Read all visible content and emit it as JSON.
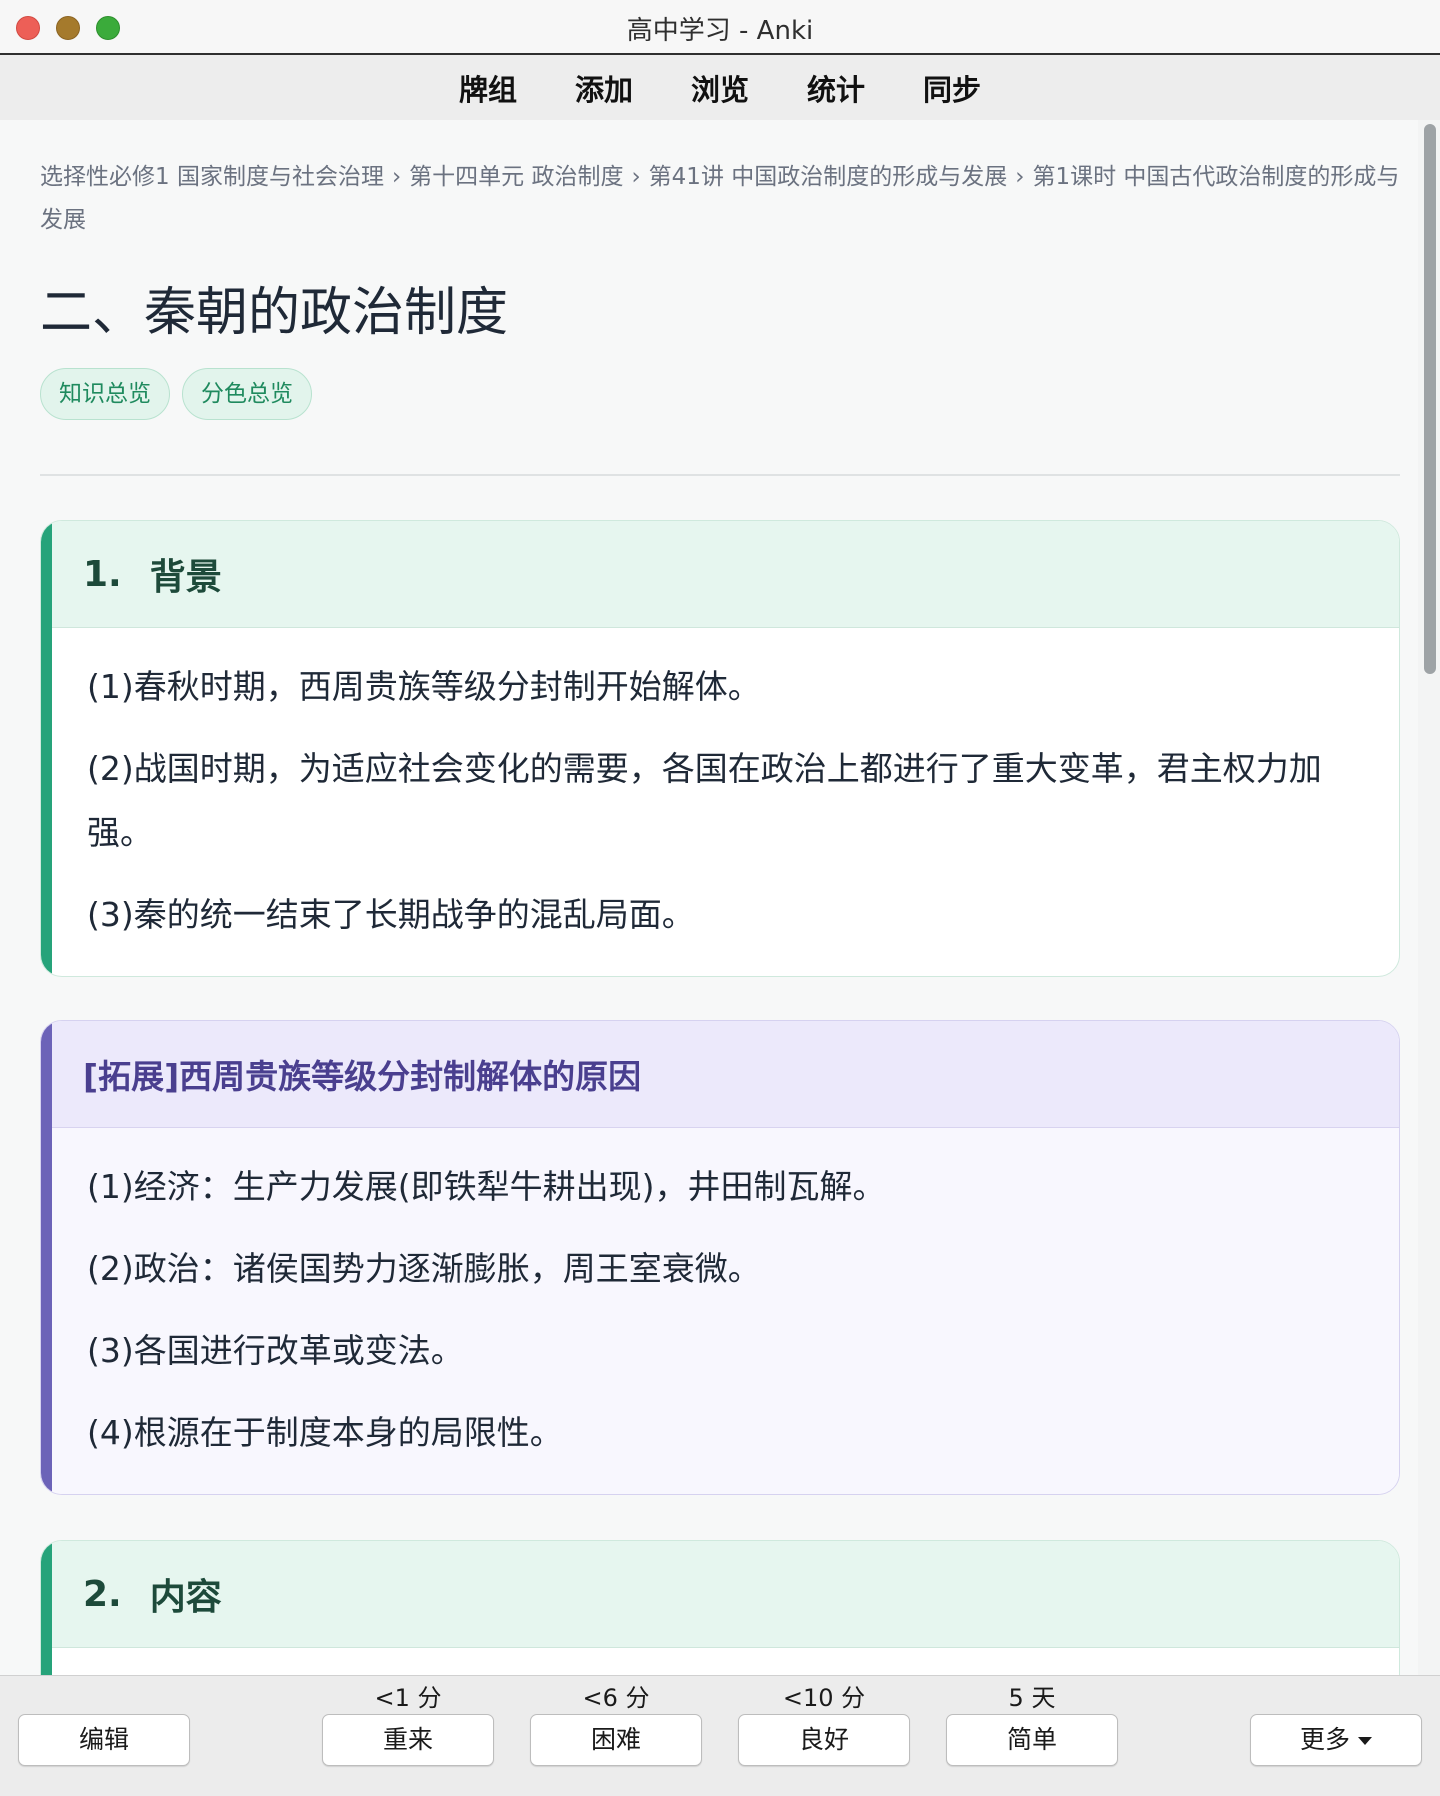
{
  "window": {
    "title": "高中学习 - Anki"
  },
  "nav": {
    "items": [
      "牌组",
      "添加",
      "浏览",
      "统计",
      "同步"
    ]
  },
  "breadcrumb": {
    "items": [
      "选择性必修1 国家制度与社会治理",
      "第十四单元 政治制度",
      "第41讲 中国政治制度的形成与发展",
      "第1课时 中国古代政治制度的形成与发展"
    ],
    "separator": "›"
  },
  "page": {
    "title": "二、秦朝的政治制度",
    "pills": [
      "知识总览",
      "分色总览"
    ]
  },
  "cards": [
    {
      "number": "1.",
      "heading": "背景",
      "lines": [
        "(1)春秋时期，西周贵族等级分封制开始解体。",
        "(2)战国时期，为适应社会变化的需要，各国在政治上都进行了重大变革，君主权力加强。",
        "(3)秦的统一结束了长期战争的混乱局面。"
      ]
    },
    {
      "number": "",
      "heading": "[拓展]西周贵族等级分封制解体的原因",
      "lines": [
        "(1)经济：生产力发展(即铁犁牛耕出现)，井田制瓦解。",
        "(2)政治：诸侯国势力逐渐膨胀，周王室衰微。",
        "(3)各国进行改革或变法。",
        "(4)根源在于制度本身的局限性。"
      ]
    },
    {
      "number": "2.",
      "heading": "内容",
      "lines": []
    }
  ],
  "bottom": {
    "edit_label": "编辑",
    "more_label": "更多",
    "answers": [
      {
        "label": "重来",
        "interval": "<1 分"
      },
      {
        "label": "困难",
        "interval": "<6 分"
      },
      {
        "label": "良好",
        "interval": "<10 分"
      },
      {
        "label": "简单",
        "interval": "5 天"
      }
    ]
  },
  "colors": {
    "accent_green": "#26a37a",
    "accent_purple": "#6c63b8",
    "pill_text": "#1f8a5e"
  }
}
